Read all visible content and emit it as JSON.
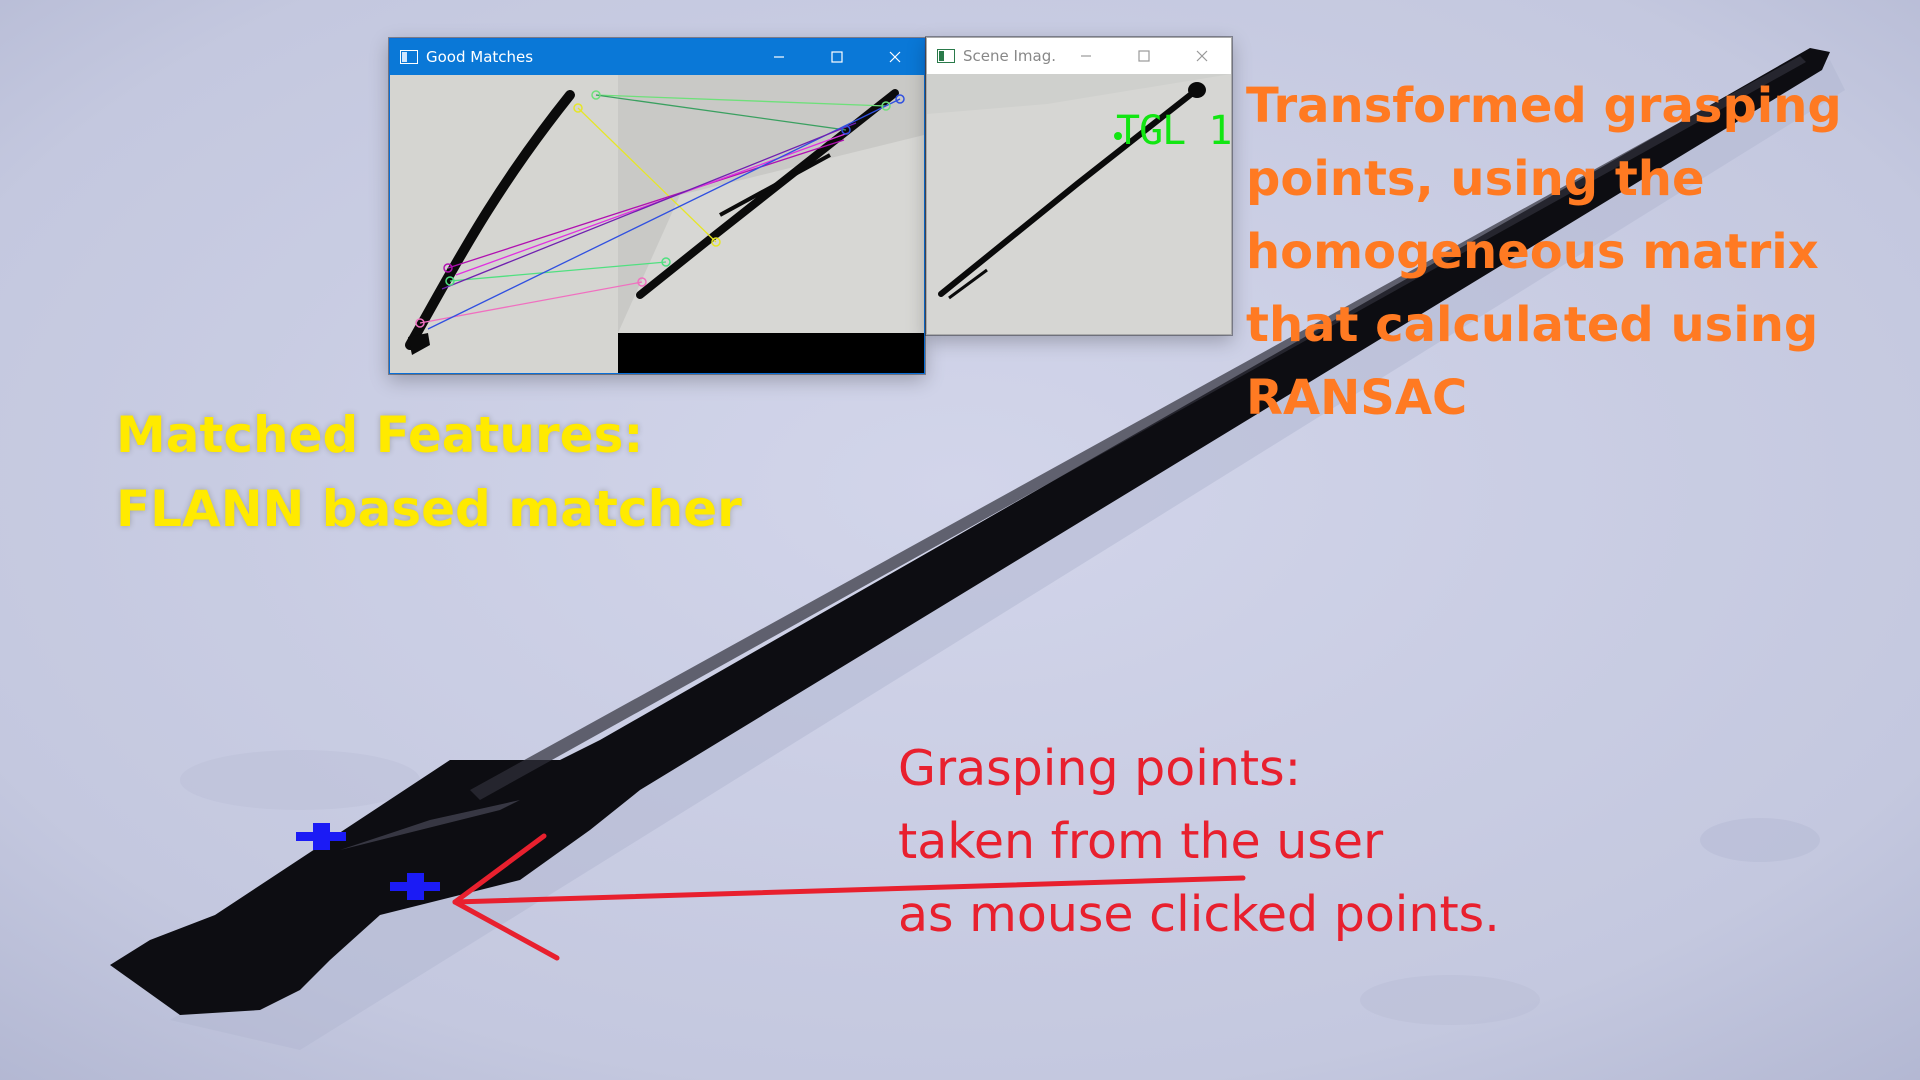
{
  "colors": {
    "background": "#c5c9e0",
    "titlebar_active": "#0a78d7",
    "annotation_yellow": "#ffea00",
    "annotation_orange": "#ff7a22",
    "annotation_red": "#e8202e",
    "grasp_marker": "#1b1bf5",
    "tag_green": "#12e612"
  },
  "windows": {
    "good_matches": {
      "title": "Good Matches",
      "icon": "app-window-icon",
      "controls": [
        "minimize-icon",
        "maximize-icon",
        "close-icon"
      ]
    },
    "scene_image": {
      "title": "Scene Imag...",
      "icon": "app-window-icon",
      "controls": [
        "minimize-icon",
        "maximize-icon",
        "close-icon"
      ],
      "object_tag": "TGL 1"
    }
  },
  "annotations": {
    "matched_features": {
      "lines": [
        "Matched Features:",
        "FLANN based matcher"
      ]
    },
    "transformed_points": {
      "lines": [
        "Transformed grasping",
        "points, using the",
        "homogeneous matrix",
        "that calculated using",
        "RANSAC"
      ]
    },
    "grasping_points": {
      "lines": [
        "Grasping points:",
        "taken from the user",
        "as mouse clicked points."
      ]
    }
  }
}
